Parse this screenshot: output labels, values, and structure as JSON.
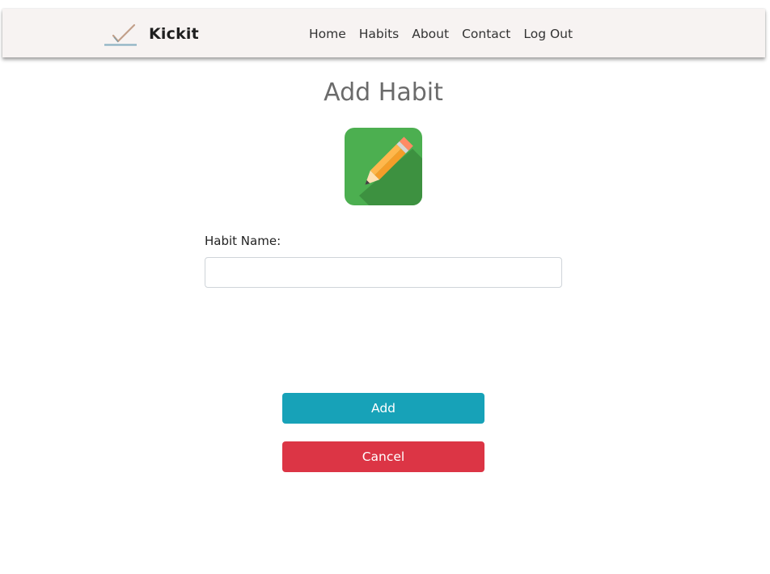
{
  "navbar": {
    "brand": "Kickit",
    "links": [
      "Home",
      "Habits",
      "About",
      "Contact",
      "Log Out"
    ]
  },
  "icons": {
    "brand": "checkmark-logo-icon",
    "habit": "pencil-icon"
  },
  "page": {
    "title": "Add Habit"
  },
  "form": {
    "habit_name_label": "Habit Name:",
    "habit_name_value": "",
    "add_label": "Add",
    "cancel_label": "Cancel"
  },
  "colors": {
    "navbar_bg": "#f7f3f2",
    "add_button": "#17a2b8",
    "cancel_button": "#dc3545",
    "icon_green": "#4caf50"
  }
}
